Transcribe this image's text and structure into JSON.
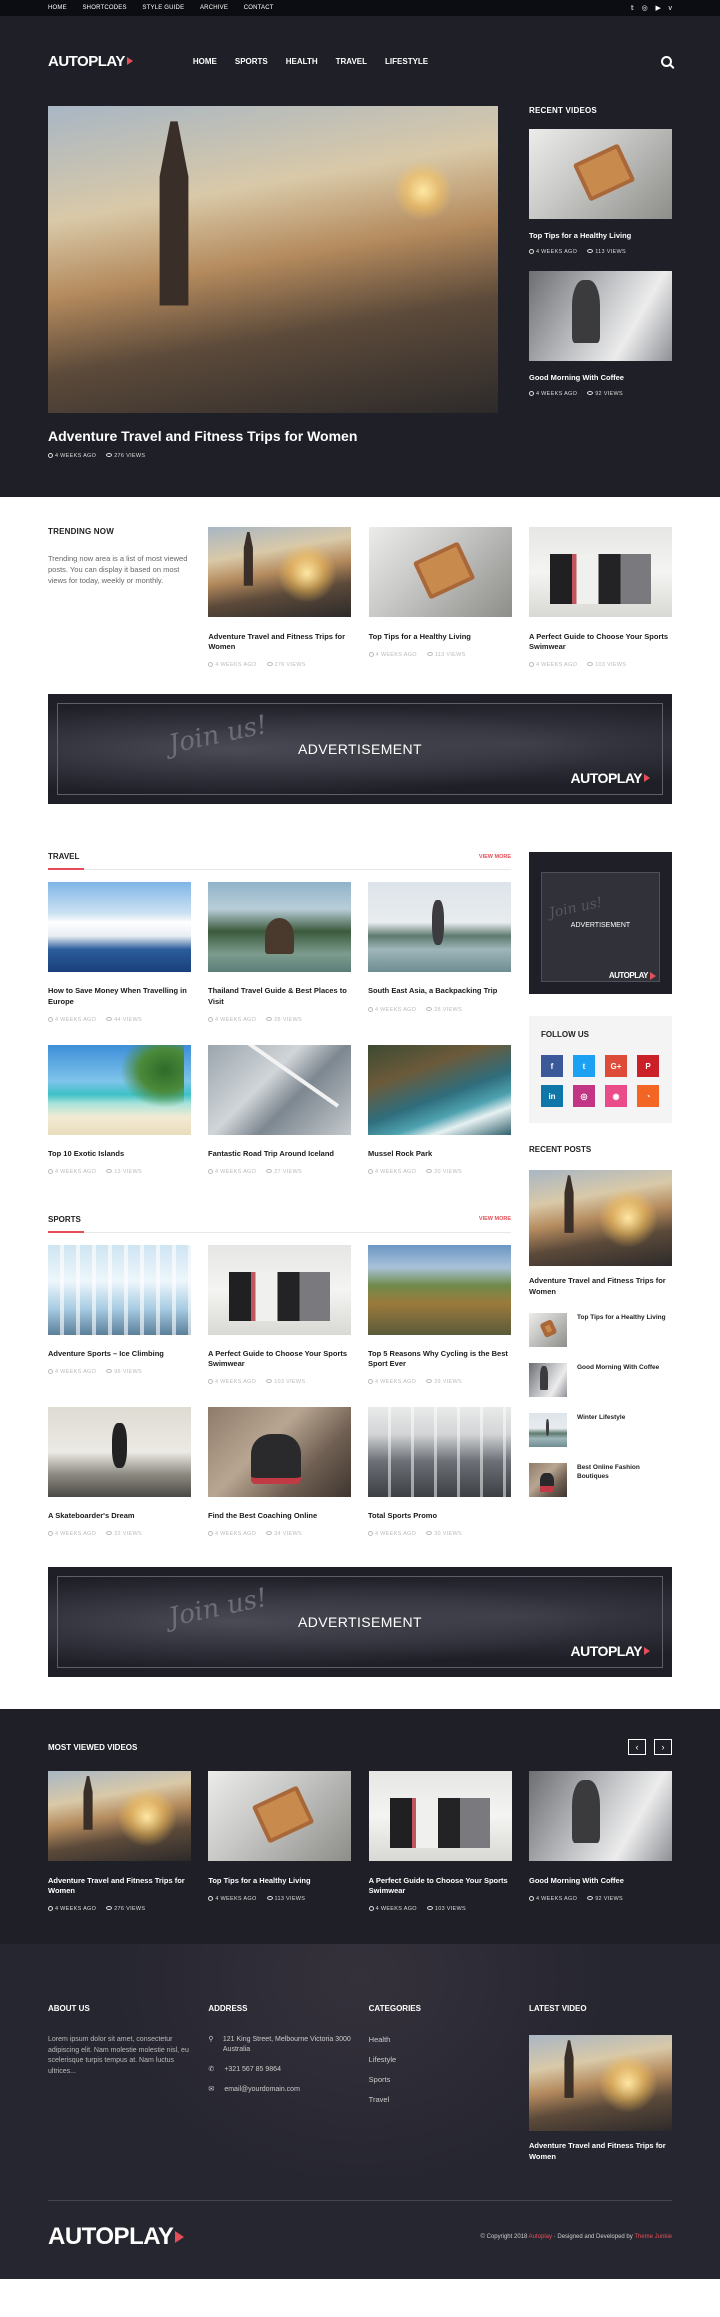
{
  "topbar": {
    "nav": [
      "HOME",
      "SHORTCODES",
      "STYLE GUIDE",
      "ARCHIVE",
      "CONTACT"
    ],
    "social": [
      "twitter-icon",
      "instagram-icon",
      "youtube-icon",
      "vimeo-icon"
    ]
  },
  "header": {
    "logo": "AUTOPLAY",
    "nav": [
      "HOME",
      "SPORTS",
      "HEALTH",
      "TRAVEL",
      "LIFESTYLE"
    ]
  },
  "hero": {
    "title": "Adventure Travel and Fitness Trips for Women",
    "time": "4 WEEKS AGO",
    "views": "276 VIEWS"
  },
  "recent_videos": {
    "heading": "RECENT VIDEOS",
    "items": [
      {
        "title": "Top Tips for a Healthy Living",
        "time": "4 WEEKS AGO",
        "views": "113 VIEWS"
      },
      {
        "title": "Good Morning With Coffee",
        "time": "4 WEEKS AGO",
        "views": "92 VIEWS"
      }
    ]
  },
  "trending": {
    "heading": "TRENDING NOW",
    "desc": "Trending now area is a list of most viewed posts. You can display it based on most views for today, weekly or monthly.",
    "items": [
      {
        "title": "Adventure Travel and Fitness Trips for Women",
        "time": "4 WEEKS AGO",
        "views": "276 VIEWS"
      },
      {
        "title": "Top Tips for a Healthy Living",
        "time": "4 WEEKS AGO",
        "views": "113 VIEWS"
      },
      {
        "title": "A Perfect Guide to Choose Your Sports Swimwear",
        "time": "4 WEEKS AGO",
        "views": "103 VIEWS"
      }
    ]
  },
  "ad": {
    "text": "ADVERTISEMENT",
    "logo": "AUTOPLAY",
    "script": "Join us!"
  },
  "travel": {
    "heading": "TRAVEL",
    "more": "VIEW MORE",
    "items": [
      {
        "title": "How to Save Money When Travelling in Europe",
        "time": "4 WEEKS AGO",
        "views": "44 VIEWS"
      },
      {
        "title": "Thailand Travel Guide & Best Places to Visit",
        "time": "4 WEEKS AGO",
        "views": "28 VIEWS"
      },
      {
        "title": "South East Asia, a Backpacking Trip",
        "time": "4 WEEKS AGO",
        "views": "28 VIEWS"
      },
      {
        "title": "Top 10 Exotic Islands",
        "time": "4 WEEKS AGO",
        "views": "13 VIEWS"
      },
      {
        "title": "Fantastic Road Trip Around Iceland",
        "time": "4 WEEKS AGO",
        "views": "27 VIEWS"
      },
      {
        "title": "Mussel Rock Park",
        "time": "4 WEEKS AGO",
        "views": "20 VIEWS"
      }
    ]
  },
  "sports": {
    "heading": "SPORTS",
    "more": "VIEW MORE",
    "items": [
      {
        "title": "Adventure Sports – Ice Climbing",
        "time": "4 WEEKS AGO",
        "views": "98 VIEWS"
      },
      {
        "title": "A Perfect Guide to Choose Your Sports Swimwear",
        "time": "4 WEEKS AGO",
        "views": "103 VIEWS"
      },
      {
        "title": "Top 5 Reasons Why Cycling is the Best Sport Ever",
        "time": "4 WEEKS AGO",
        "views": "29 VIEWS"
      },
      {
        "title": "A Skateboarder's Dream",
        "time": "4 WEEKS AGO",
        "views": "22 VIEWS"
      },
      {
        "title": "Find the Best Coaching Online",
        "time": "4 WEEKS AGO",
        "views": "34 VIEWS"
      },
      {
        "title": "Total Sports Promo",
        "time": "4 WEEKS AGO",
        "views": "30 VIEWS"
      }
    ]
  },
  "sidebar": {
    "ad": {
      "text": "ADVERTISEMENT",
      "logo": "AUTOPLAY",
      "script": "Join us!"
    },
    "follow": {
      "heading": "FOLLOW US",
      "icons": [
        {
          "name": "facebook-icon",
          "glyph": "f",
          "color": "#3b5998"
        },
        {
          "name": "twitter-icon",
          "glyph": "t",
          "color": "#1da1f2"
        },
        {
          "name": "google-plus-icon",
          "glyph": "G+",
          "color": "#dd4b39"
        },
        {
          "name": "pinterest-icon",
          "glyph": "P",
          "color": "#cb2027"
        },
        {
          "name": "linkedin-icon",
          "glyph": "in",
          "color": "#0e76a8"
        },
        {
          "name": "instagram-icon",
          "glyph": "◎",
          "color": "#c13584"
        },
        {
          "name": "dribbble-icon",
          "glyph": "◉",
          "color": "#ea4c89"
        },
        {
          "name": "rss-icon",
          "glyph": "◔",
          "color": "#f26522"
        }
      ]
    },
    "recent_posts": {
      "heading": "RECENT POSTS",
      "featured": "Adventure Travel and Fitness Trips for Women",
      "items": [
        "Top Tips for a Healthy Living",
        "Good Morning With Coffee",
        "Winter Lifestyle",
        "Best Online Fashion Boutiques"
      ]
    }
  },
  "most_viewed": {
    "heading": "MOST VIEWED VIDEOS",
    "prev": "‹",
    "next": "›",
    "items": [
      {
        "title": "Adventure Travel and Fitness Trips for Women",
        "time": "4 WEEKS AGO",
        "views": "276 VIEWS"
      },
      {
        "title": "Top Tips for a Healthy Living",
        "time": "4 WEEKS AGO",
        "views": "113 VIEWS"
      },
      {
        "title": "A Perfect Guide to Choose Your Sports Swimwear",
        "time": "4 WEEKS AGO",
        "views": "103 VIEWS"
      },
      {
        "title": "Good Morning With Coffee",
        "time": "4 WEEKS AGO",
        "views": "92 VIEWS"
      }
    ]
  },
  "footer": {
    "about": {
      "heading": "ABOUT US",
      "text": "Lorem ipsum dolor sit amet, consectetur adipiscing elit. Nam molestie molestie nisl, eu scelerisque turpis tempus at. Nam luctus ultrices..."
    },
    "address": {
      "heading": "ADDRESS",
      "street": "121 King Street, Melbourne Victoria 3000 Australia",
      "phone": "+321 567 85 9864",
      "email": "email@yourdomain.com"
    },
    "categories": {
      "heading": "CATEGORIES",
      "items": [
        "Health",
        "Lifestyle",
        "Sports",
        "Travel"
      ]
    },
    "latest_video": {
      "heading": "LATEST VIDEO",
      "title": "Adventure Travel and Fitness Trips for Women"
    },
    "logo": "AUTOPLAY",
    "copyright_pre": "© Copyright 2018 ",
    "copyright_brand": "Autoplay",
    "copyright_mid": " · Designed and Developed by ",
    "copyright_dev": "Theme Junkie"
  },
  "colors": {
    "accent": "#e54e57",
    "dark": "#1e1f27",
    "footer": "#262630"
  }
}
